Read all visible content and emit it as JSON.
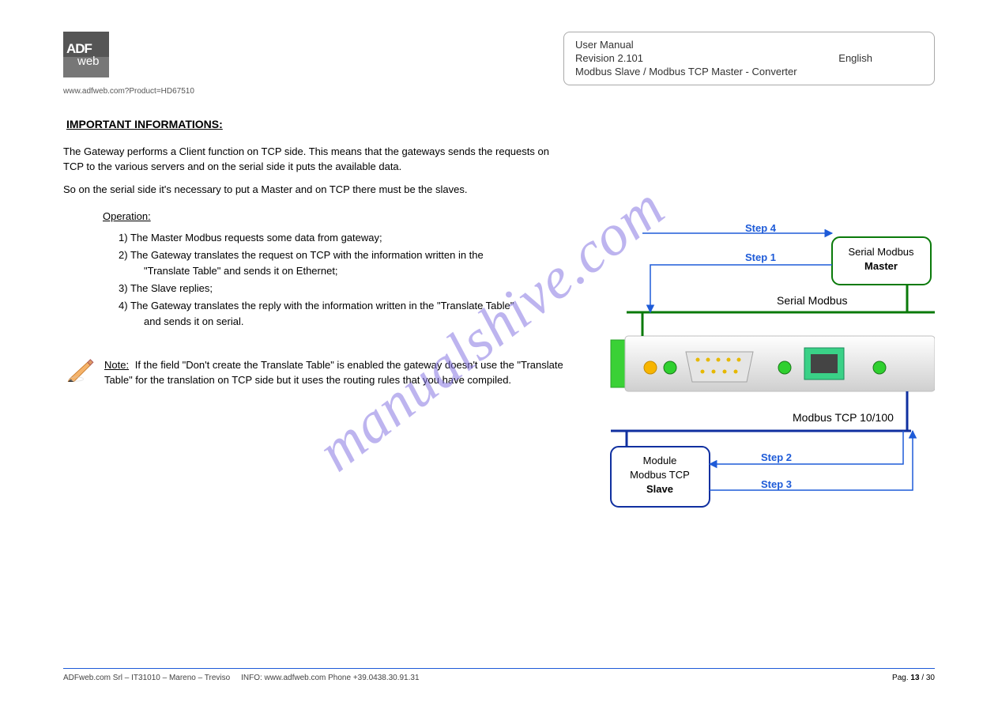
{
  "logo": {
    "line1": "ADF",
    "line2": "web"
  },
  "header_box": {
    "line1": "User Manual",
    "line2_label": "Revision",
    "line2_rev": "2.101",
    "line2_en": "English",
    "line3": "Modbus Slave / Modbus TCP Master - Converter"
  },
  "company_url": "www.adfweb.com?Product=HD67510",
  "heading": "IMPORTANT INFORMATIONS:",
  "intro": "The Gateway performs a Client function on TCP side. This means that the gateways sends the requests on TCP to the various servers and on the serial side it puts the available data.",
  "intro2": "So on the serial side it's necessary to put a Master and on TCP there must be the slaves.",
  "operation_label": "Operation:",
  "steps": [
    {
      "k": "1)",
      "v": "The Master Modbus requests some data from gateway;"
    },
    {
      "k": "2)",
      "v": "The Gateway translates the request on TCP with the information written in the \"Translate Table\" and sends it on Ethernet;"
    },
    {
      "k": "3)",
      "v": "The Slave replies;"
    },
    {
      "k": "4)",
      "v": "The Gateway translates the reply with the information written in the \"Translate Table\" and sends it on serial."
    }
  ],
  "note_label": "Note:",
  "note_text": "If the field \"Don't create the Translate Table\" is enabled the gateway doesn't use the \"Translate Table\" for the translation on TCP side but it uses the routing rules that you have compiled.",
  "diagram": {
    "step1": "Step 1",
    "step2": "Step 2",
    "step3": "Step 3",
    "step4": "Step 4",
    "serial": "Serial Modbus",
    "tcp": "Modbus TCP 10/100",
    "master1": "Serial Modbus",
    "master2": "Master",
    "slave1": "Module",
    "slave2": "Modbus TCP",
    "slave3": "Slave"
  },
  "footer": {
    "addr": "ADFweb.com Srl – IT31010 – Mareno – Treviso",
    "contact": "INFO: www.adfweb.com   Phone +39.0438.30.91.31",
    "page_label": "Pag.",
    "page_n": "13",
    "page_of": "/ 30"
  },
  "watermark": "manualshive.com"
}
